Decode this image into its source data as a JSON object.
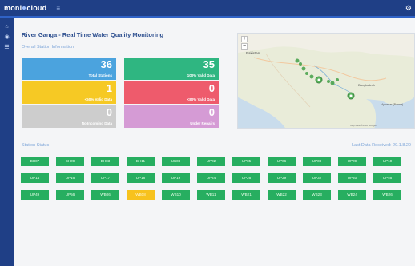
{
  "app": {
    "brand_left": "moni",
    "brand_right": "cloud"
  },
  "page": {
    "title": "River Ganga - Real Time Water Quality Monitoring",
    "overall_label": "Overall Station Information"
  },
  "cards": [
    {
      "value": "36",
      "label": "Total Stations",
      "color": "#4ba3de"
    },
    {
      "value": "35",
      "label": "100% Valid Data",
      "color": "#2fb681"
    },
    {
      "value": "1",
      "label": "<50% Valid Data",
      "color": "#f6c924"
    },
    {
      "value": "0",
      "label": "<80% Valid Data",
      "color": "#ee5b6c"
    },
    {
      "value": "0",
      "label": "No Incoming Data",
      "color": "#cdcdcd"
    },
    {
      "value": "0",
      "label": "Under Repairs",
      "color": "#d59bd5"
    }
  ],
  "map": {
    "country_label": "Pakistan",
    "region_label": "Bangladesh",
    "region_label_2": "Myanmar (Burma)",
    "attribution": "Map data ©2018 Google"
  },
  "stations_section": {
    "label": "Station Status",
    "last_received": "Last Data Received: 29.1.8.20"
  },
  "stations": [
    {
      "name": "BH07",
      "status": "ok"
    },
    {
      "name": "BH09",
      "status": "ok"
    },
    {
      "name": "BH03",
      "status": "ok"
    },
    {
      "name": "BH11",
      "status": "ok"
    },
    {
      "name": "UK08",
      "status": "ok"
    },
    {
      "name": "UP02",
      "status": "ok"
    },
    {
      "name": "UP05",
      "status": "ok"
    },
    {
      "name": "UP06",
      "status": "ok"
    },
    {
      "name": "UP08",
      "status": "ok"
    },
    {
      "name": "UP09",
      "status": "ok"
    },
    {
      "name": "UP10",
      "status": "ok"
    },
    {
      "name": "UP14",
      "status": "ok"
    },
    {
      "name": "UP16",
      "status": "ok"
    },
    {
      "name": "UP17",
      "status": "ok"
    },
    {
      "name": "UP18",
      "status": "ok"
    },
    {
      "name": "UP19",
      "status": "ok"
    },
    {
      "name": "UP24",
      "status": "ok"
    },
    {
      "name": "UP26",
      "status": "ok"
    },
    {
      "name": "UP29",
      "status": "ok"
    },
    {
      "name": "UP32",
      "status": "ok"
    },
    {
      "name": "UP40",
      "status": "ok"
    },
    {
      "name": "UP46",
      "status": "ok"
    },
    {
      "name": "UP49",
      "status": "ok"
    },
    {
      "name": "UP56",
      "status": "ok"
    },
    {
      "name": "WB06",
      "status": "ok"
    },
    {
      "name": "WB08",
      "status": "warn"
    },
    {
      "name": "WB10",
      "status": "ok"
    },
    {
      "name": "WB11",
      "status": "ok"
    },
    {
      "name": "WB21",
      "status": "ok"
    },
    {
      "name": "WB22",
      "status": "ok"
    },
    {
      "name": "WB23",
      "status": "ok"
    },
    {
      "name": "WB24",
      "status": "ok"
    },
    {
      "name": "WB26",
      "status": "ok"
    }
  ],
  "status_colors": {
    "ok": "#27ae60",
    "warn": "#f7c21e"
  },
  "icons": {
    "menu": "hamburger-icon",
    "settings": "gear-icon",
    "home": "home-icon",
    "dashboard": "dashboard-icon",
    "list": "list-icon"
  }
}
